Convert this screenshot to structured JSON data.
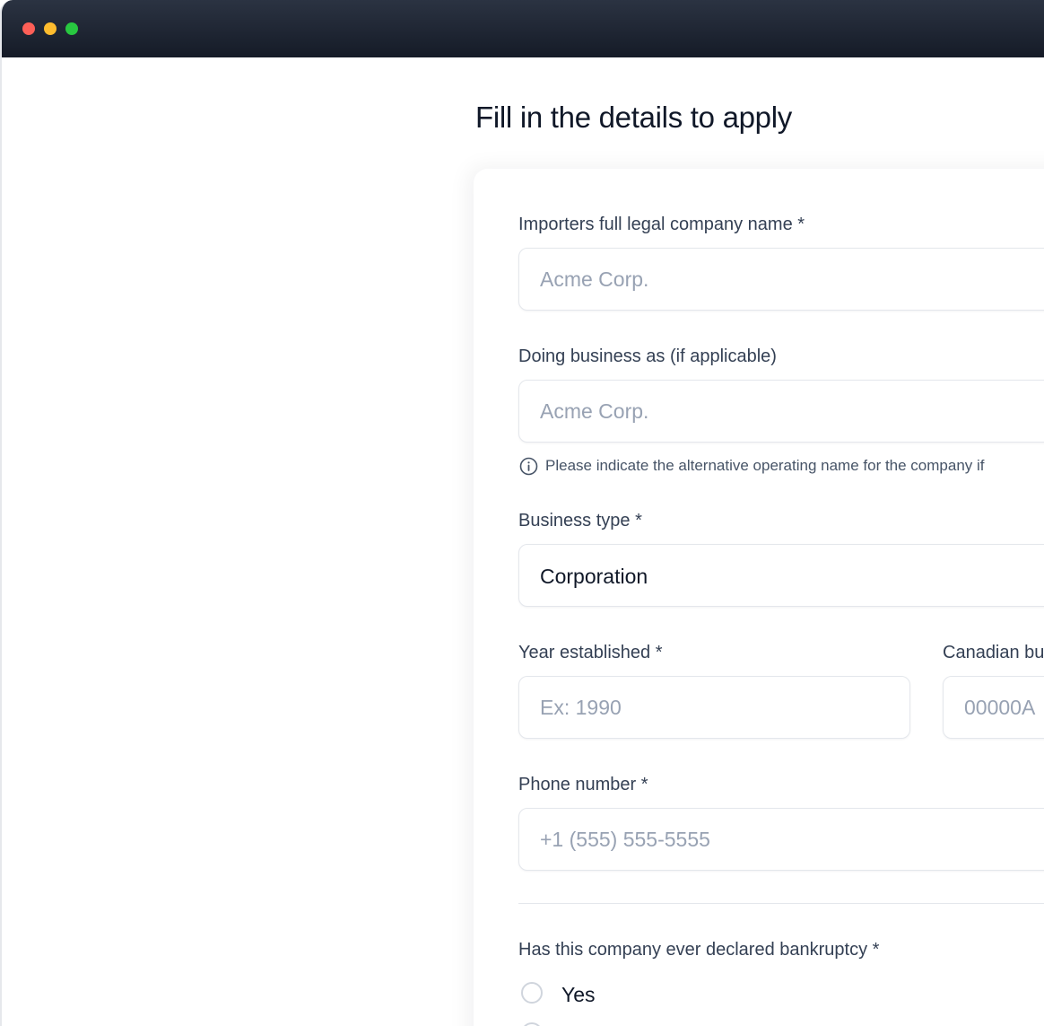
{
  "page": {
    "title": "Fill in the details to apply"
  },
  "form": {
    "legal_name": {
      "label": "Importers full legal company name *",
      "placeholder": "Acme Corp."
    },
    "dba": {
      "label": "Doing business as (if applicable)",
      "placeholder": "Acme Corp.",
      "hint": "Please indicate the alternative operating name for the company if"
    },
    "business_type": {
      "label": "Business type *",
      "value": "Corporation"
    },
    "year_established": {
      "label": "Year established *",
      "placeholder": "Ex: 1990"
    },
    "canadian_bn": {
      "label": "Canadian bu",
      "placeholder": "00000A"
    },
    "phone": {
      "label": "Phone number *",
      "placeholder": "+1 (555) 555-5555"
    },
    "bankruptcy": {
      "label": "Has this company ever declared bankruptcy *",
      "options": [
        "Yes"
      ]
    }
  },
  "icons": {
    "hint_icon": "info-icon"
  },
  "colors": {
    "titlebar": "#1b2230",
    "close": "#fe5f57",
    "minimize": "#febc2e",
    "maximize": "#28c840",
    "placeholder": "#98a2b3",
    "label": "#344054"
  }
}
